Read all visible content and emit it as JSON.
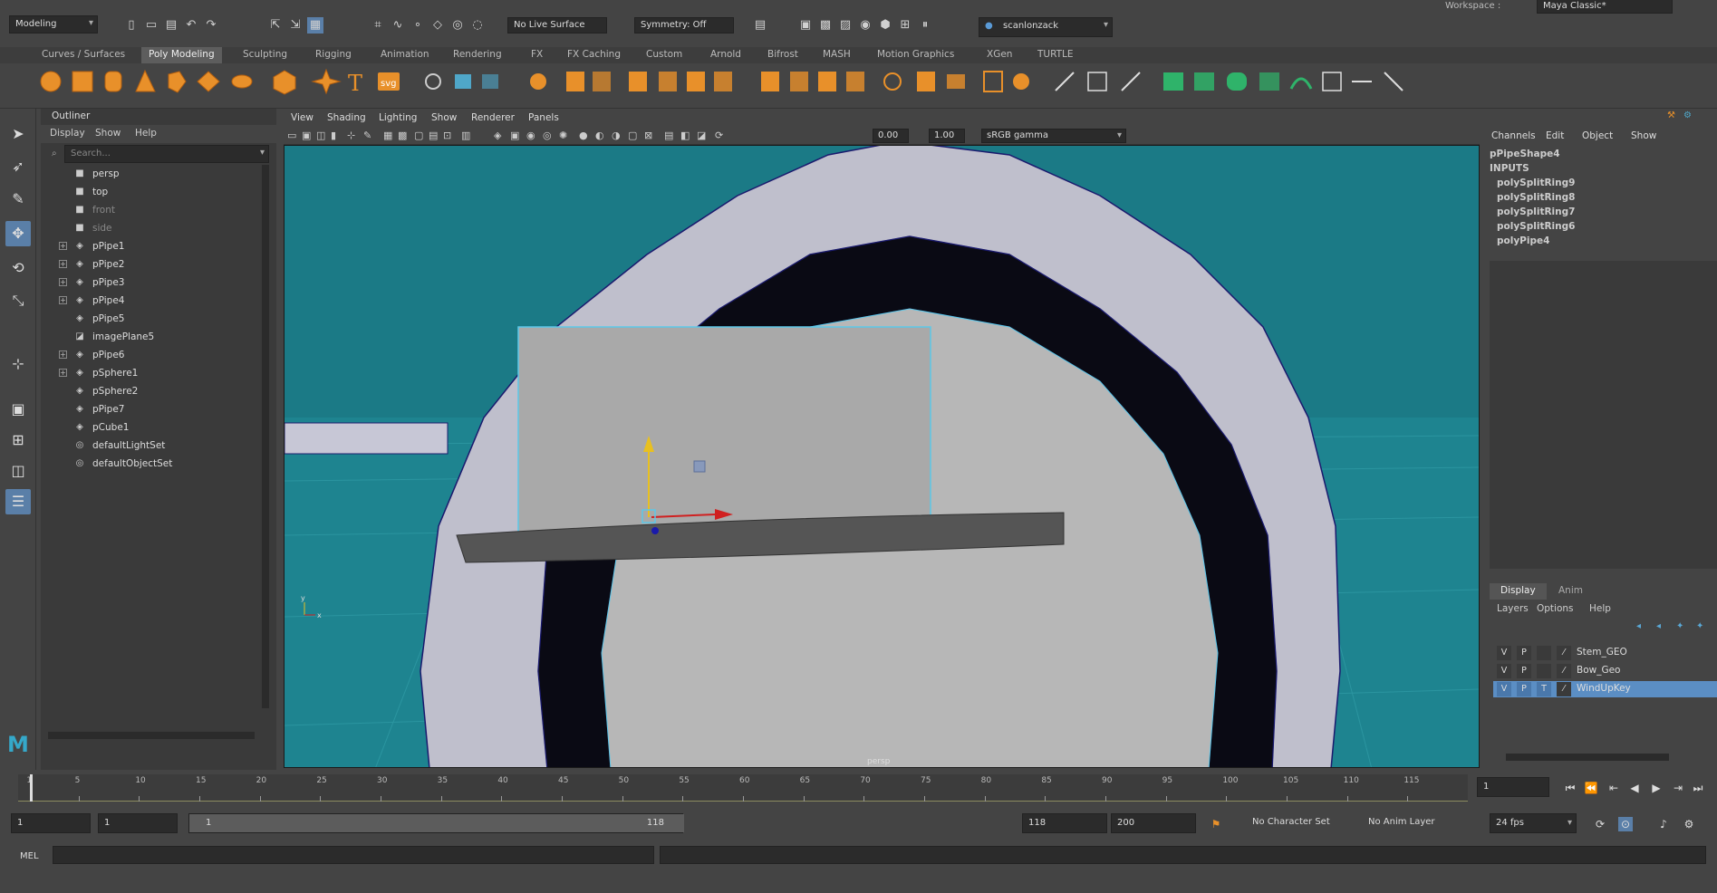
{
  "status": {
    "mode_menu": "Modeling",
    "live_surface": "No Live Surface",
    "symmetry": "Symmetry: Off",
    "user": "scanlonzack",
    "workspace_label": "Workspace :",
    "workspace": "Maya Classic*"
  },
  "shelf_tabs": [
    "Curves / Surfaces",
    "Poly Modeling",
    "Sculpting",
    "Rigging",
    "Animation",
    "Rendering",
    "FX",
    "FX Caching",
    "Custom",
    "Arnold",
    "Bifrost",
    "MASH",
    "Motion Graphics",
    "XGen",
    "TURTLE"
  ],
  "shelf_active": "Poly Modeling",
  "shelf_svg_label": "svg",
  "shelf_text_label": "T",
  "outliner": {
    "title": "Outliner",
    "menus": [
      "Display",
      "Show",
      "Help"
    ],
    "search_placeholder": "Search...",
    "items": [
      {
        "label": "persp",
        "icon": "camera-icon",
        "dim": false,
        "expandable": false
      },
      {
        "label": "top",
        "icon": "camera-icon",
        "dim": false,
        "expandable": false
      },
      {
        "label": "front",
        "icon": "camera-icon",
        "dim": true,
        "expandable": false
      },
      {
        "label": "side",
        "icon": "camera-icon",
        "dim": true,
        "expandable": false
      },
      {
        "label": "pPipe1",
        "icon": "mesh-icon",
        "dim": false,
        "expandable": true
      },
      {
        "label": "pPipe2",
        "icon": "mesh-icon",
        "dim": false,
        "expandable": true
      },
      {
        "label": "pPipe3",
        "icon": "mesh-icon",
        "dim": false,
        "expandable": true
      },
      {
        "label": "pPipe4",
        "icon": "mesh-icon",
        "dim": false,
        "expandable": true
      },
      {
        "label": "pPipe5",
        "icon": "mesh-icon",
        "dim": false,
        "expandable": false
      },
      {
        "label": "imagePlane5",
        "icon": "image-plane-icon",
        "dim": false,
        "expandable": false
      },
      {
        "label": "pPipe6",
        "icon": "mesh-icon",
        "dim": false,
        "expandable": true
      },
      {
        "label": "pSphere1",
        "icon": "mesh-icon",
        "dim": false,
        "expandable": true
      },
      {
        "label": "pSphere2",
        "icon": "mesh-icon",
        "dim": false,
        "expandable": false
      },
      {
        "label": "pPipe7",
        "icon": "mesh-icon",
        "dim": false,
        "expandable": false
      },
      {
        "label": "pCube1",
        "icon": "mesh-icon",
        "dim": false,
        "expandable": false
      },
      {
        "label": "defaultLightSet",
        "icon": "set-icon",
        "dim": false,
        "expandable": false
      },
      {
        "label": "defaultObjectSet",
        "icon": "set-icon",
        "dim": false,
        "expandable": false
      }
    ]
  },
  "viewport": {
    "menus": [
      "View",
      "Shading",
      "Lighting",
      "Show",
      "Renderer",
      "Panels"
    ],
    "exposure": "0.00",
    "gamma": "1.00",
    "color_space": "sRGB gamma",
    "camera_label": "persp",
    "axis_y": "y",
    "axis_x": "x"
  },
  "channel_box": {
    "menus": [
      "Channels",
      "Edit",
      "Object",
      "Show"
    ],
    "shape": "pPipeShape4",
    "inputs_label": "INPUTS",
    "inputs": [
      "polySplitRing9",
      "polySplitRing8",
      "polySplitRing7",
      "polySplitRing6",
      "polyPipe4"
    ]
  },
  "layers": {
    "tabs": [
      "Display",
      "Anim"
    ],
    "menus": [
      "Layers",
      "Options",
      "Help"
    ],
    "rows": [
      {
        "v": "V",
        "p": "P",
        "t": "",
        "name": "Stem_GEO",
        "selected": false
      },
      {
        "v": "V",
        "p": "P",
        "t": "",
        "name": "Bow_Geo",
        "selected": false
      },
      {
        "v": "V",
        "p": "P",
        "t": "T",
        "name": "WindUpKey",
        "selected": true
      }
    ]
  },
  "timeline": {
    "ticks": [
      "1",
      "5",
      "10",
      "15",
      "20",
      "25",
      "30",
      "35",
      "40",
      "45",
      "50",
      "55",
      "60",
      "65",
      "70",
      "75",
      "80",
      "85",
      "90",
      "95",
      "100",
      "105",
      "110",
      "115"
    ],
    "current_frame": "1"
  },
  "range": {
    "start": "1",
    "playback_start": "1",
    "slider_start": "1",
    "slider_end": "118",
    "playback_end": "118",
    "end": "200",
    "character_set": "No Character Set",
    "anim_layer": "No Anim Layer",
    "fps": "24 fps"
  },
  "command": {
    "lang": "MEL"
  },
  "colors": {
    "viewport_bg": "#1b7a86",
    "selection": "#5b8ec4",
    "shelf_orange": "#e8902a"
  }
}
